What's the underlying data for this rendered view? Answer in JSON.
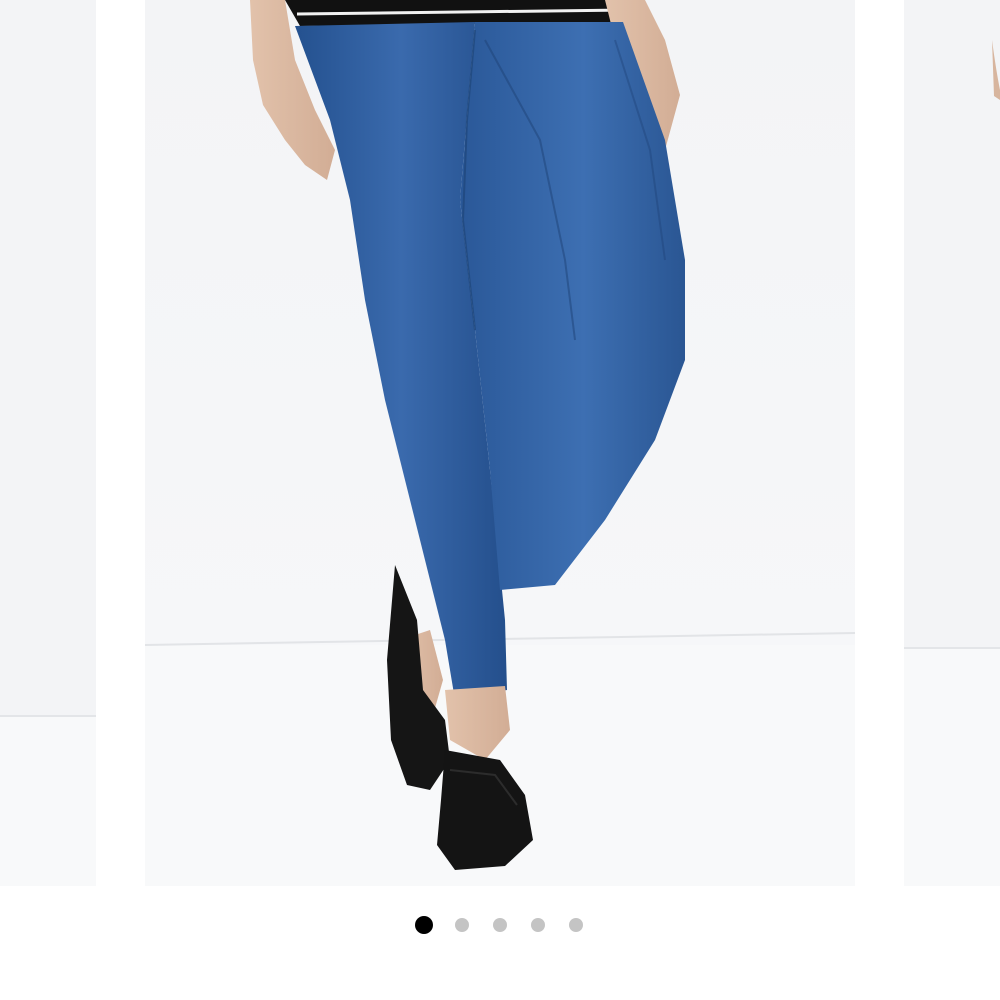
{
  "carousel": {
    "colors": {
      "backdrop": "#f4f5f7",
      "floor": "#f7f8f9",
      "denim": "#2c5b9c",
      "shoe": "#141414",
      "top": "#111111"
    },
    "pagination": {
      "total": 5,
      "active_index": 0,
      "active_color": "#000000",
      "inactive_color": "#c4c4c4"
    }
  }
}
